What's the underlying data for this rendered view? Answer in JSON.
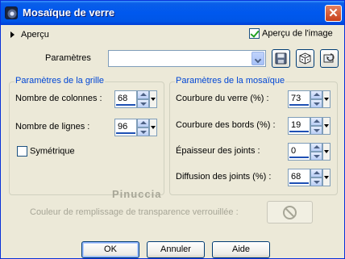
{
  "window": {
    "title": "Mosaïque de verre",
    "close_glyph": "✕"
  },
  "preview": {
    "label": "Aperçu",
    "image_preview_label": "Aperçu de l'image",
    "image_preview_checked": true
  },
  "presets": {
    "label": "Paramètres",
    "value": ""
  },
  "grid_group": {
    "title": "Paramètres de la grille",
    "columns_label": "Nombre de colonnes :",
    "columns_value": "68",
    "rows_label": "Nombre de lignes :",
    "rows_value": "96",
    "symmetric_label": "Symétrique",
    "symmetric_checked": false
  },
  "mosaic_group": {
    "title": "Paramètres de la mosaïque",
    "glass_curve_label": "Courbure du verre (%) :",
    "glass_curve_value": "73",
    "edge_curve_label": "Courbure des bords (%) :",
    "edge_curve_value": "19",
    "joint_thickness_label": "Épaisseur des joints :",
    "joint_thickness_value": "0",
    "joint_diffusion_label": "Diffusion des joints (%) :",
    "joint_diffusion_value": "68"
  },
  "locked_color": {
    "label": "Couleur de remplissage de transparence verrouillée :"
  },
  "watermark": "Pinuccia",
  "buttons": {
    "ok": "OK",
    "cancel": "Annuler",
    "help": "Aide"
  },
  "colors": {
    "title_bar": "#0058ee",
    "group_title": "#0046d5",
    "dialog_bg": "#ece9d8"
  }
}
